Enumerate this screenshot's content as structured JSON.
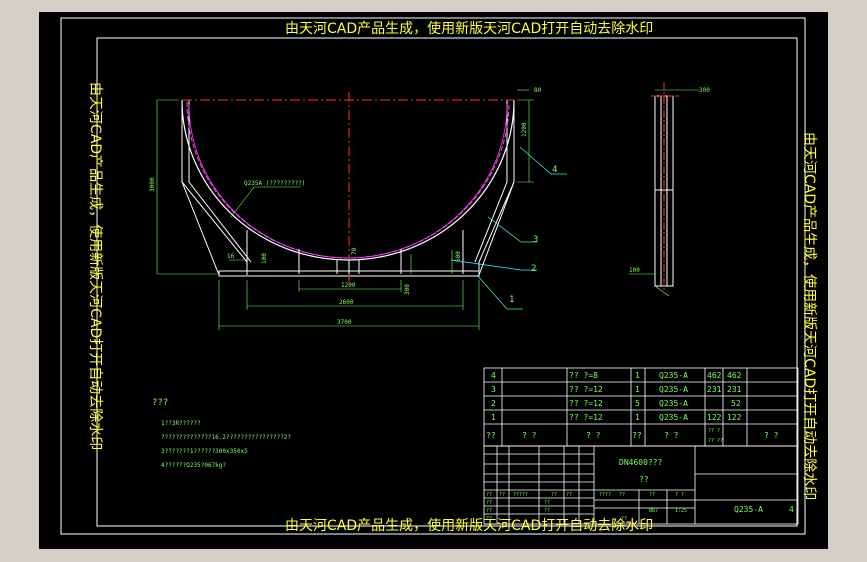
{
  "watermark": {
    "top": "由天河CAD产品生成，使用新版天河CAD打开自动去除水印",
    "bottom": "由天河CAD产品生成，使用新版天河CAD打开自动去除水印",
    "left": "由天河CAD产品生成，使用新版天河CAD打开自动去除水印",
    "right": "由天河CAD产品生成，使用新版天河CAD打开自动去除水印"
  },
  "drawing": {
    "note_arc": "Q235A (?????????)",
    "dims": {
      "top_right": "80",
      "right_height": "1200",
      "left_height": "3000",
      "bottom_width": "3700",
      "inner_width": "2600",
      "center_width": "1200",
      "left_small_1": "16",
      "left_small_2": "100",
      "rib_height": "600",
      "center_height": "70",
      "center_small": "300",
      "side_top": "300",
      "side_left": "100"
    },
    "balloons": [
      "4",
      "3",
      "2",
      "1"
    ]
  },
  "notes": {
    "heading": "???",
    "lines": [
      "1??3R??????",
      "??????????????16.2????????????????2?",
      "3???????1??????300x350x5",
      "4??????Q235?067kg?"
    ]
  },
  "bom": {
    "rows": [
      {
        "no": "4",
        "name": "?? ?=8",
        "qty": "1",
        "material": "Q235-A",
        "w1": "462",
        "w2": "462"
      },
      {
        "no": "3",
        "name": "?? ?=12",
        "qty": "1",
        "material": "Q235-A",
        "w1": "231",
        "w2": "231"
      },
      {
        "no": "2",
        "name": "?? ?=12",
        "qty": "5",
        "material": "Q235-A",
        "w1": "",
        "w2": "52"
      },
      {
        "no": "1",
        "name": "?? ?=12",
        "qty": "1",
        "material": "Q235-A",
        "w1": "122",
        "w2": "122"
      }
    ],
    "header": {
      "no": "??",
      "code": "?  ?",
      "name": "?  ?",
      "qty": "??",
      "material": "?  ?",
      "w1": "??  ?",
      "w1b": "??  ??",
      "remark": "?  ?"
    }
  },
  "title_block": {
    "product": "DN4600???",
    "sub": "??",
    "scale_label": "??",
    "weight_label": "??",
    "sheet_label": "?  ?",
    "scale": "1:25",
    "weight": "867",
    "material": "Q235-A",
    "sheet_no": "4",
    "small_cells": [
      "??",
      "??",
      "?????",
      "??",
      "??",
      "????",
      "??",
      "??",
      "??",
      "??",
      "??",
      "??"
    ]
  },
  "colors": {
    "background": "#000000",
    "frame": "#ffffff",
    "part": "#ffffff",
    "dimension": "#7dff5a",
    "centerline": "#ff3030",
    "hidden": "#ff40ff",
    "leader": "#33ffff",
    "watermark": "#ffff33"
  }
}
